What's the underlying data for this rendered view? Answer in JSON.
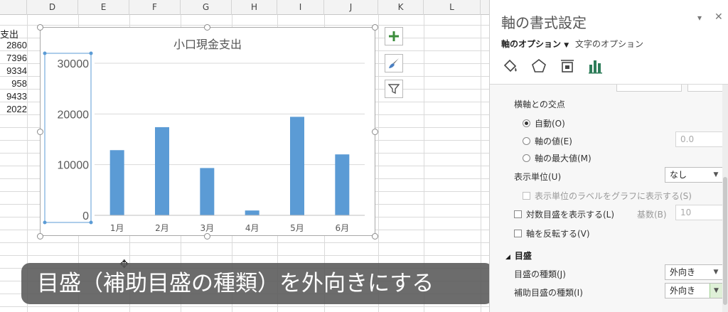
{
  "sheet": {
    "columns": [
      "D",
      "E",
      "F",
      "G",
      "H",
      "I",
      "J",
      "K",
      "L"
    ],
    "header_cell": "支出",
    "values": [
      "2860",
      "7396",
      "9334",
      "958",
      "9433",
      "2022"
    ]
  },
  "chart_data": {
    "type": "bar",
    "title": "小口現金支出",
    "categories": [
      "1月",
      "2月",
      "3月",
      "4月",
      "5月",
      "6月"
    ],
    "values": [
      12860,
      17396,
      9334,
      958,
      19433,
      12022
    ],
    "ylim": [
      0,
      30000
    ],
    "yticks": [
      "30000",
      "20000",
      "10000",
      "0"
    ],
    "ytick_values": [
      30000,
      20000,
      10000,
      0
    ],
    "bar_color": "#5b9bd5",
    "grid": true
  },
  "caption": "目盛（補助目盛の種類）を外向きにする",
  "pane": {
    "title": "軸の書式設定",
    "tab_axis": "軸のオプション",
    "tab_text": "文字のオプション",
    "icons": [
      "fill-line-icon",
      "effects-pentagon-icon",
      "size-properties-icon",
      "axis-options-bar-icon"
    ],
    "crossing_label": "横軸との交点",
    "radio_auto": "自動(O)",
    "radio_value": "軸の値(E)",
    "radio_max": "軸の最大値(M)",
    "value_field": "0.0",
    "display_unit_label": "表示単位(U)",
    "display_unit_value": "なし",
    "show_unit_label": "表示単位のラベルをグラフに表示する(S)",
    "log_scale_label": "対数目盛を表示する(L)",
    "base_label": "基数(B)",
    "base_value": "10",
    "reverse_label": "軸を反転する(V)",
    "section_ticks": "目盛",
    "major_tick_label": "目盛の種類(J)",
    "major_tick_value": "外向き",
    "minor_tick_label": "補助目盛の種類(I)",
    "minor_tick_value": "外向き"
  }
}
